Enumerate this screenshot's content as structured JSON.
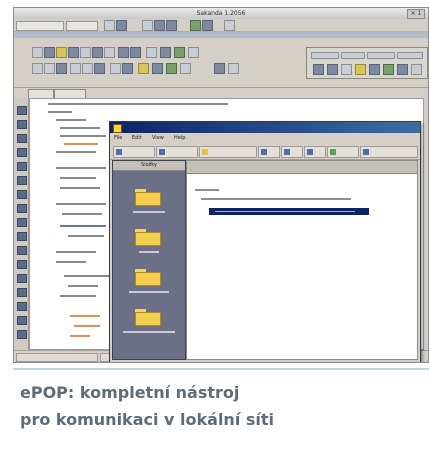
{
  "screenshot": {
    "window_title": "Sakanda 1.2056",
    "close_label": "× 1"
  },
  "popup": {
    "menu": [
      "File",
      "Edit",
      "View",
      "Help"
    ],
    "folders_header": "Složky"
  },
  "caption": {
    "line1": "ePOP: kompletní nástroj",
    "line2": "pro komunikaci v lokální síti"
  }
}
